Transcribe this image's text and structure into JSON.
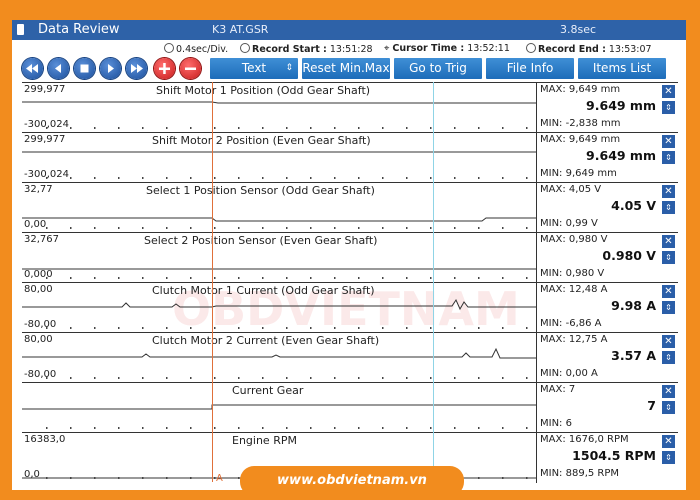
{
  "window": {
    "title": "Data Review",
    "file": "K3 AT.GSR",
    "duration": "3.8sec"
  },
  "info": {
    "div": "0.4sec/Div.",
    "record_start_label": "Record Start :",
    "record_start": "13:51:28",
    "cursor_time_label": "Cursor Time :",
    "cursor_time": "13:52:11",
    "record_end_label": "Record End :",
    "record_end": "13:53:07"
  },
  "toolbar": {
    "mode": "Text",
    "reset": "Reset Min.Max",
    "goto": "Go to Trig",
    "fileinfo": "File Info",
    "items": "Items List"
  },
  "cursors": {
    "a": "A",
    "b": "B"
  },
  "channels": [
    {
      "name": "Shift Motor 1 Position (Odd Gear Shaft)",
      "ymax": "299,977",
      "ymin": "-300,024",
      "max": "MAX: 9,649 mm",
      "current": "9.649 mm",
      "min": "MIN: -2,838 mm"
    },
    {
      "name": "Shift Motor 2 Position (Even Gear Shaft)",
      "ymax": "299,977",
      "ymin": "-300,024",
      "max": "MAX: 9,649 mm",
      "current": "9.649 mm",
      "min": "MIN: 9,649 mm"
    },
    {
      "name": "Select 1 Position Sensor (Odd Gear Shaft)",
      "ymax": "32,77",
      "ymin": "0,00",
      "max": "MAX: 4,05 V",
      "current": "4.05 V",
      "min": "MIN: 0,99 V"
    },
    {
      "name": "Select 2 Position Sensor (Even Gear Shaft)",
      "ymax": "32,767",
      "ymin": "0,000",
      "max": "MAX: 0,980 V",
      "current": "0.980 V",
      "min": "MIN: 0,980 V"
    },
    {
      "name": "Clutch Motor 1 Current (Odd Gear Shaft)",
      "ymax": "80,00",
      "ymin": "-80,00",
      "max": "MAX: 12,48 A",
      "current": "9.98 A",
      "min": "MIN: -6,86 A"
    },
    {
      "name": "Clutch Motor 2 Current (Even Gear Shaft)",
      "ymax": "80,00",
      "ymin": "-80,00",
      "max": "MAX: 12,75 A",
      "current": "3.57 A",
      "min": "MIN: 0,00 A"
    },
    {
      "name": "Current Gear",
      "ymax": "",
      "ymin": "",
      "max": "MAX: 7",
      "current": "7",
      "min": "MIN: 6"
    },
    {
      "name": "Engine RPM",
      "ymax": "16383,0",
      "ymin": "0,0",
      "max": "MAX: 1676,0 RPM",
      "current": "1504.5 RPM",
      "min": "MIN: 889,5 RPM"
    }
  ],
  "watermark": "OBDVIETNAM",
  "footer": "www.obdvietnam.vn",
  "colors": {
    "accent": "#2e62a8",
    "frame": "#f28c1e",
    "cursor_a": "#e0703a",
    "cursor_b": "#8fd4e6"
  }
}
